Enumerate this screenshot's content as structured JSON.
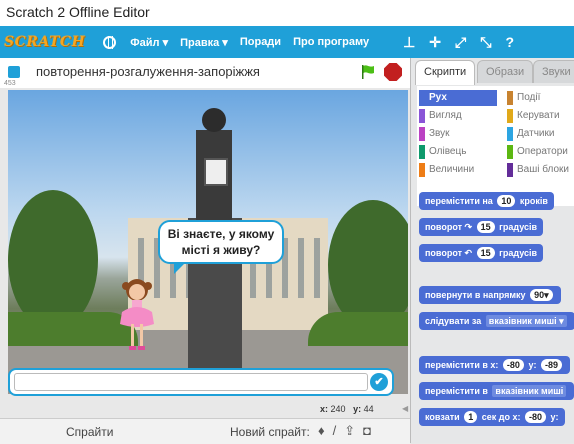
{
  "window": {
    "title": "Scratch 2 Offline Editor"
  },
  "menubar": {
    "logo": "SCRATCH",
    "items": [
      "Файл ▾",
      "Правка ▾",
      "Поради",
      "Про програму"
    ]
  },
  "stage": {
    "project_title": "повторення-розгалуження-запоріжжя",
    "version": "453",
    "speech": "Ві знаєте, у якому місті я живу?",
    "ask_ok": "✔",
    "coords": {
      "x_label": "x:",
      "x": "240",
      "y_label": "y:",
      "y": "44"
    }
  },
  "sprites": {
    "label": "Спрайти",
    "new_sprite": "Новий спрайт:"
  },
  "right_panel": {
    "tabs": [
      "Скрипти",
      "Образи",
      "Звуки"
    ],
    "categories": [
      {
        "label": "Рух",
        "color": "#4a6cd4"
      },
      {
        "label": "Події",
        "color": "#c88330"
      },
      {
        "label": "Вигляд",
        "color": "#8a55d7"
      },
      {
        "label": "Керувати",
        "color": "#e1a91a"
      },
      {
        "label": "Звук",
        "color": "#bb42c3"
      },
      {
        "label": "Датчики",
        "color": "#2ca5e2"
      },
      {
        "label": "Олівець",
        "color": "#0e9a6c"
      },
      {
        "label": "Оператори",
        "color": "#5cb712"
      },
      {
        "label": "Величини",
        "color": "#ee7d16"
      },
      {
        "label": "Ваші блоки",
        "color": "#632d99"
      }
    ],
    "blocks": {
      "move": {
        "pre": "перемістити на",
        "val": "10",
        "post": "кроків"
      },
      "turn_right": {
        "pre": "поворот",
        "arrow": "↷",
        "val": "15",
        "post": "градусів"
      },
      "turn_left": {
        "pre": "поворот",
        "arrow": "↶",
        "val": "15",
        "post": "градусів"
      },
      "point_dir": {
        "pre": "повернути в напрямку",
        "val": "90▾"
      },
      "point_towards": {
        "pre": "слідувати за",
        "val": "вказівник миші ▾"
      },
      "goto_xy": {
        "pre": "перемістити в x:",
        "x": "-80",
        "y_label": "y:",
        "y": "-89"
      },
      "goto": {
        "pre": "перемістити в",
        "val": "вказівник миші"
      },
      "glide": {
        "pre": "ковзати",
        "val": "1",
        "mid": "сек до x:",
        "x": "-80",
        "y_label": "y:"
      }
    }
  }
}
